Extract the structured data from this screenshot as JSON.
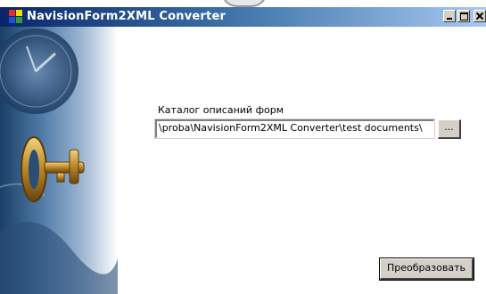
{
  "window": {
    "title": "NavisionForm2XML Converter",
    "title_color": "#ffffff",
    "titlebar_color": "#0a246a"
  },
  "form": {
    "catalog_label": "Каталог описаний форм",
    "catalog_path": "\\proba\\NavisionForm2XML Converter\\test documents\\",
    "browse_label": "...",
    "convert_label": "Преобразовать"
  },
  "icons": {
    "app": "app-logo-icon",
    "minimize": "minimize-icon",
    "maximize": "maximize-icon",
    "close": "close-icon",
    "side_image": "key-clock-illustration"
  }
}
